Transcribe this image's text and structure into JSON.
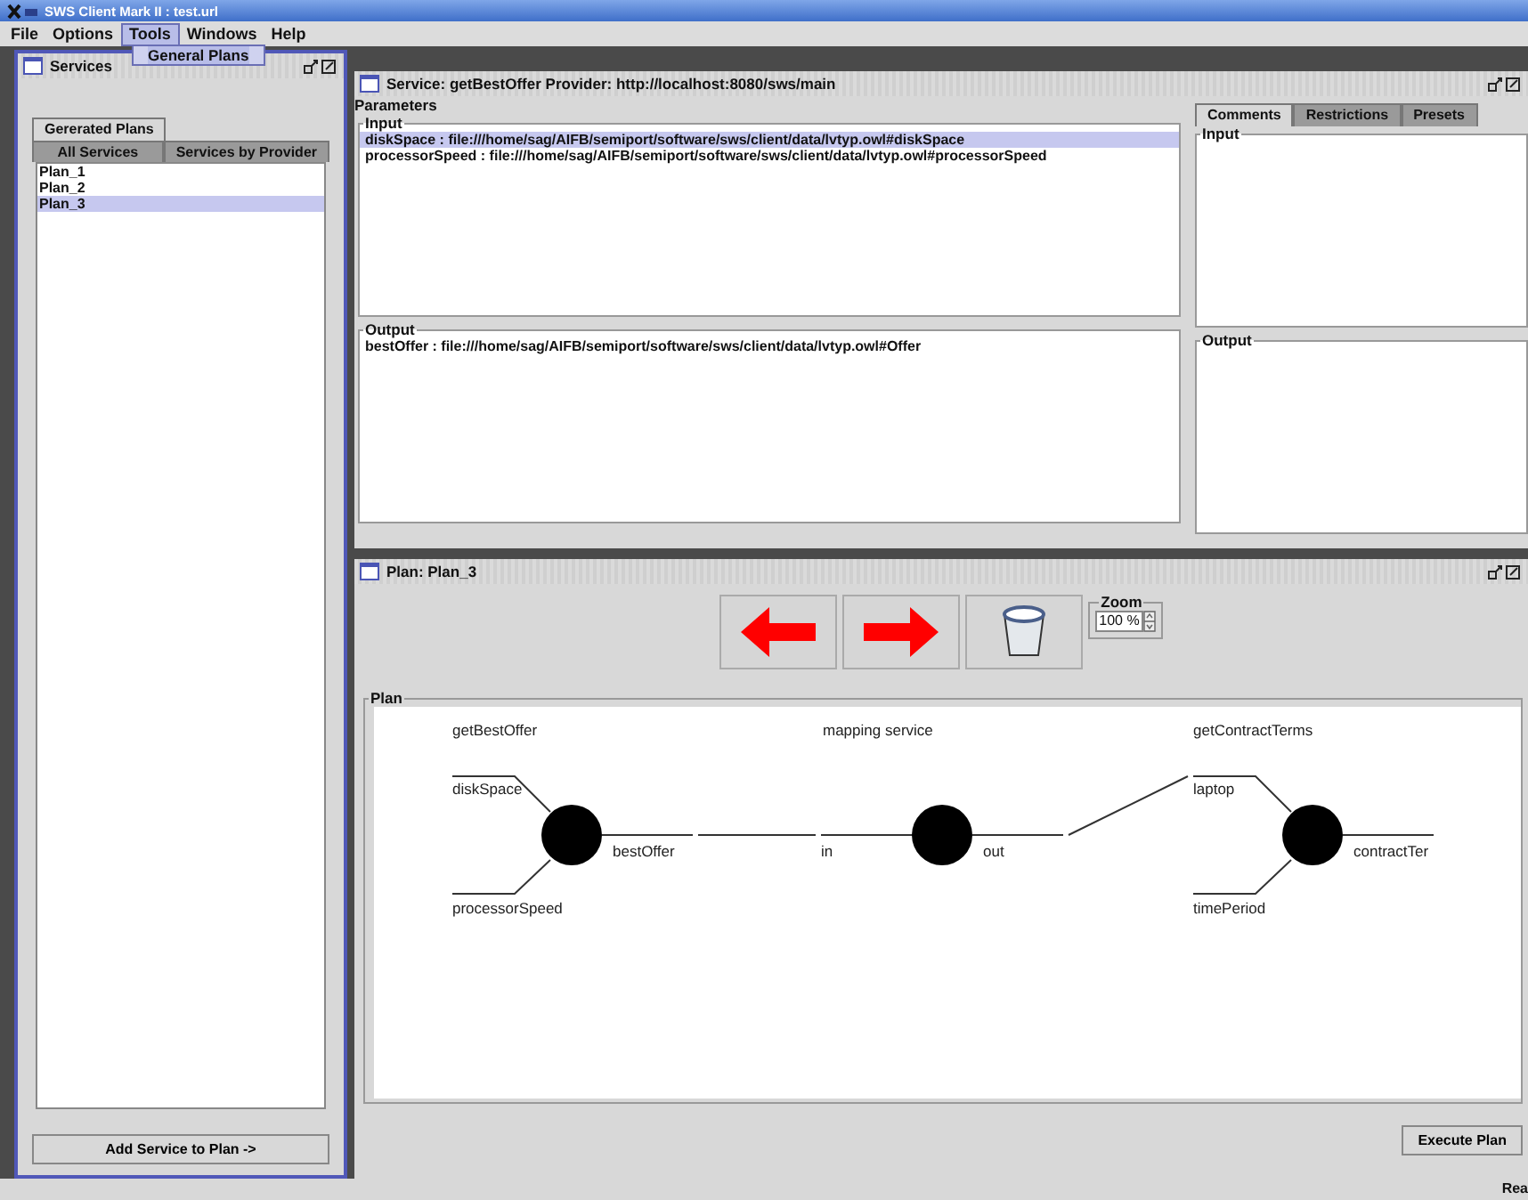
{
  "window": {
    "title": "SWS Client Mark II : test.url"
  },
  "menu": [
    {
      "label": "File",
      "selected": false
    },
    {
      "label": "Options",
      "selected": false
    },
    {
      "label": "Tools",
      "selected": true
    },
    {
      "label": "Windows",
      "selected": false
    },
    {
      "label": "Help",
      "selected": false
    }
  ],
  "open_menu": {
    "items": [
      {
        "label": "General Plans",
        "selected": true
      }
    ]
  },
  "services_panel": {
    "title": "Services",
    "tabs_row_1": [
      {
        "label": "Gererated Plans",
        "selected": true
      }
    ],
    "tabs_row_2": [
      {
        "label": "All Services",
        "selected": false
      },
      {
        "label": "Services by Provider",
        "selected": false
      }
    ],
    "plans": [
      {
        "label": "Plan_1",
        "selected": false
      },
      {
        "label": "Plan_2",
        "selected": false
      },
      {
        "label": "Plan_3",
        "selected": true
      }
    ],
    "button": "Add Service to Plan ->"
  },
  "service_panel": {
    "title": "Service: getBestOffer Provider: http://localhost:8080/sws/main",
    "parameters_label": "Parameters",
    "input_label": "Input",
    "inputs": [
      {
        "label": "diskSpace : file:///home/sag/AIFB/semiport/software/sws/client/data/lvtyp.owl#diskSpace",
        "selected": true
      },
      {
        "label": "processorSpeed : file:///home/sag/AIFB/semiport/software/sws/client/data/lvtyp.owl#processorSpeed",
        "selected": false
      }
    ],
    "output_label": "Output",
    "outputs": [
      {
        "label": "bestOffer : file:///home/sag/AIFB/semiport/software/sws/client/data/lvtyp.owl#Offer",
        "selected": false
      }
    ],
    "side_tabs": [
      {
        "label": "Comments",
        "selected": true
      },
      {
        "label": "Restrictions",
        "selected": false
      },
      {
        "label": "Presets",
        "selected": false
      }
    ],
    "side_input_label": "Input",
    "side_output_label": "Output"
  },
  "plan_panel": {
    "title": "Plan: Plan_3",
    "zoom_label": "Zoom",
    "zoom_value": "100 %",
    "plan_label": "Plan",
    "services": [
      {
        "title": "getBestOffer",
        "inputs": [
          "diskSpace",
          "processorSpeed"
        ],
        "outputs": [
          "bestOffer"
        ]
      },
      {
        "title": "mapping service",
        "inputs": [
          "in"
        ],
        "outputs": [
          "out"
        ]
      },
      {
        "title": "getContractTerms",
        "inputs": [
          "laptop",
          "timePeriod"
        ],
        "outputs": [
          "contractTer"
        ]
      }
    ],
    "button": "Execute Plan"
  },
  "status_bar": "Rea"
}
